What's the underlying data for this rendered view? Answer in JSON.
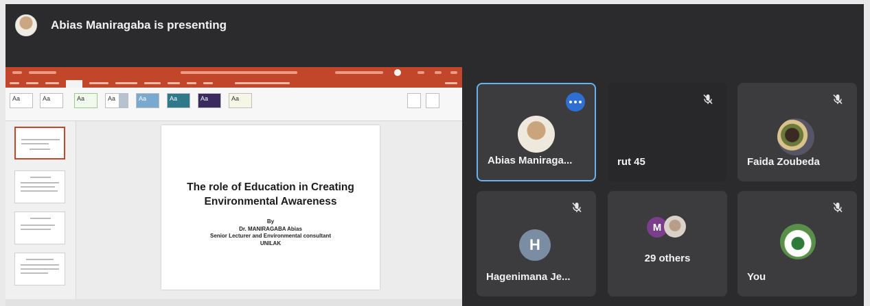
{
  "header": {
    "presenting_text": "Abias Maniragaba is presenting"
  },
  "slide": {
    "title": "The role of Education in Creating\nEnvironmental Awareness",
    "body": "By\nDr. MANIRAGABA Abias\nSenior Lecturer and Environmental consultant\nUNILAK"
  },
  "participants": {
    "abias": {
      "name": "Abias Maniraga...",
      "more_icon": "more-options-icon"
    },
    "rut": {
      "name": "rut 45",
      "mic": "mic-off-icon"
    },
    "faida": {
      "name": "Faida Zoubeda",
      "mic": "mic-off-icon"
    },
    "hagenimana": {
      "name": "Hagenimana Je...",
      "initial": "H",
      "mic": "mic-off-icon"
    },
    "others": {
      "initial": "M",
      "label": "29 others",
      "mic": "mic-off-icon"
    },
    "you": {
      "name": "You",
      "mic": "mic-off-icon"
    }
  },
  "colors": {
    "background": "#2b2b2d",
    "tile": "#3c3c3f",
    "active_speaker_border": "#66b3f0",
    "more_button": "#2f6fd1",
    "powerpoint_accent": "#c2472a"
  }
}
